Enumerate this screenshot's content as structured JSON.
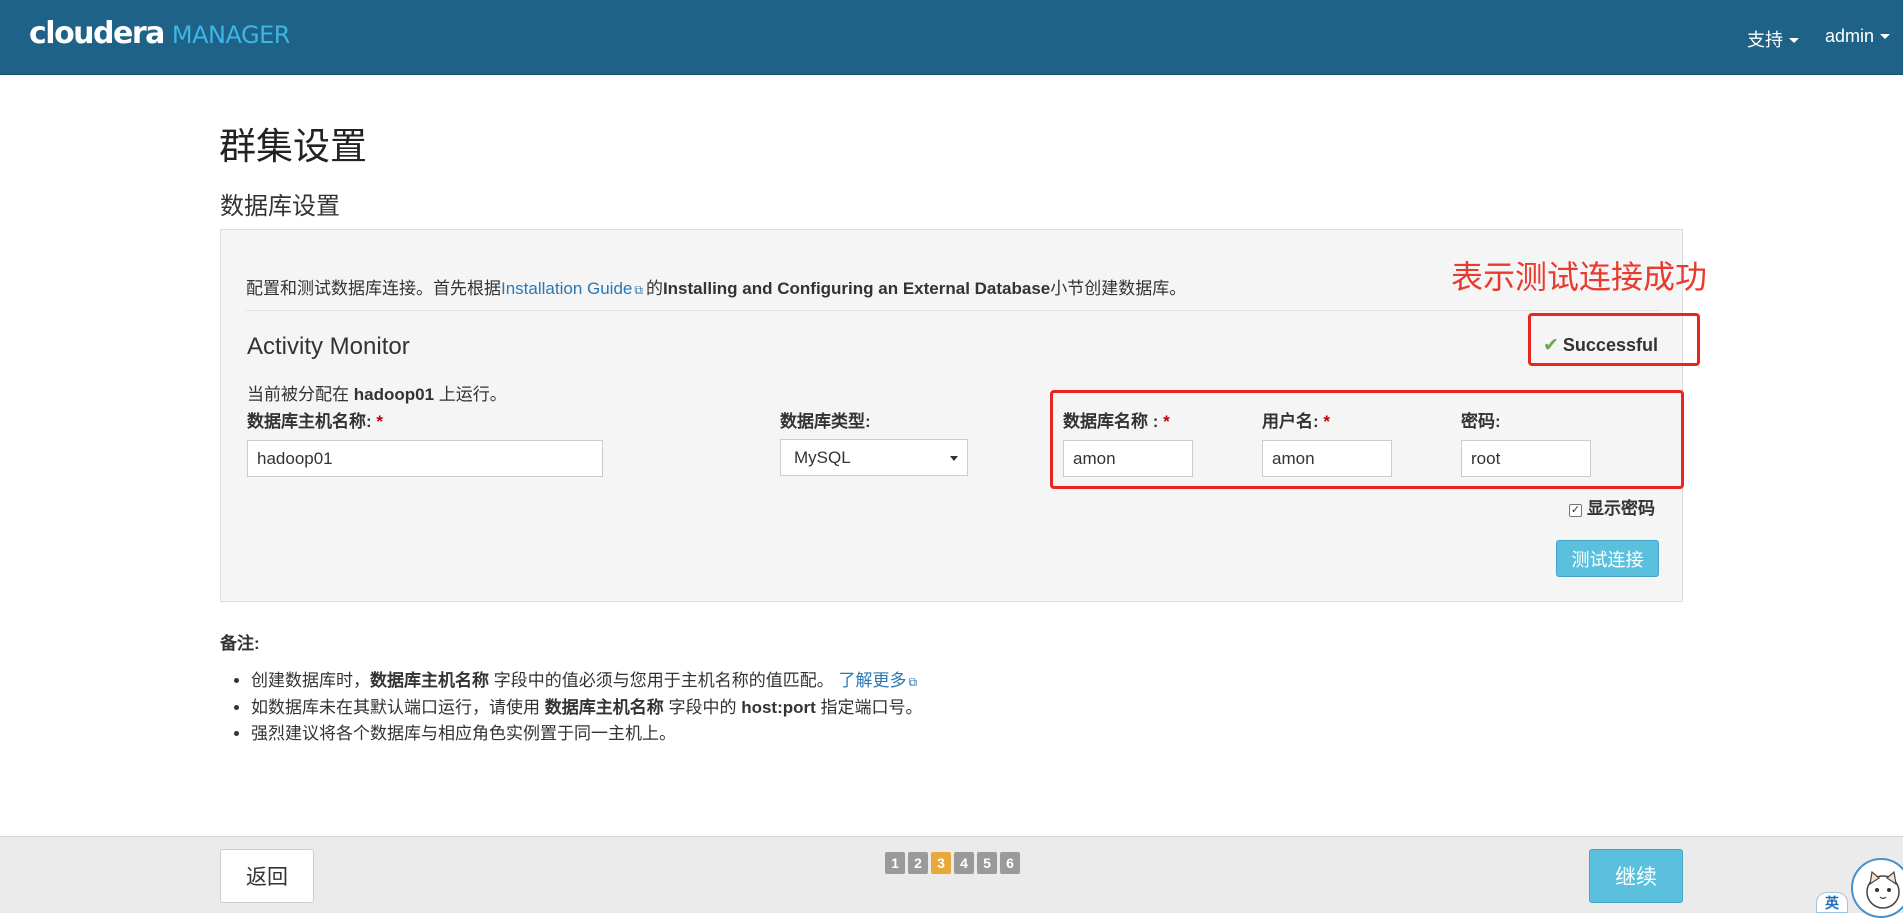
{
  "header": {
    "logo_main": "cloudera",
    "logo_sub": "MANAGER",
    "support_menu": "支持",
    "user_menu": "admin"
  },
  "page": {
    "title": "群集设置",
    "section_title": "数据库设置"
  },
  "panel": {
    "intro_prefix": "配置和测试数据库连接。首先根据",
    "intro_link": "Installation Guide",
    "intro_mid": "的",
    "intro_bold": "Installing and Configuring an External Database",
    "intro_suffix": "小节创建数据库。",
    "service_title": "Activity Monitor",
    "assigned_prefix": "当前被分配在",
    "assigned_host": "hadoop01",
    "assigned_suffix": "上运行。",
    "status": "Successful",
    "fields": {
      "host_label": "数据库主机名称:",
      "host_value": "hadoop01",
      "type_label": "数据库类型:",
      "type_value": "MySQL",
      "dbname_label": "数据库名称 :",
      "dbname_value": "amon",
      "user_label": "用户名:",
      "user_value": "amon",
      "password_label": "密码:",
      "password_value": "root",
      "required_mark": "*"
    },
    "show_password_label": "显示密码",
    "test_button": "测试连接"
  },
  "notes": {
    "title": "备注:",
    "item1_prefix": "创建数据库时，",
    "item1_bold": "数据库主机名称",
    "item1_suffix": "字段中的值必须与您用于主机名称的值匹配。",
    "item1_link": "了解更多",
    "item2_prefix": "如数据库未在其默认端口运行，请使用",
    "item2_bold1": "数据库主机名称",
    "item2_mid": "字段中的",
    "item2_bold2": "host:port",
    "item2_suffix": "指定端口号。",
    "item3": "强烈建议将各个数据库与相应角色实例置于同一主机上。"
  },
  "annotation": {
    "text": "表示测试连接成功",
    "color": "#e8261d"
  },
  "footer": {
    "back_button": "返回",
    "continue_button": "继续",
    "steps": [
      "1",
      "2",
      "3",
      "4",
      "5",
      "6"
    ],
    "active_step": "3"
  },
  "ime": {
    "label": "英"
  },
  "colors": {
    "navbar": "#1e6287",
    "brand_accent": "#3fb4e6",
    "primary_button": "#5bc0de",
    "link": "#2a77b3",
    "success": "#6aa84f",
    "active_step": "#e9a93a"
  }
}
